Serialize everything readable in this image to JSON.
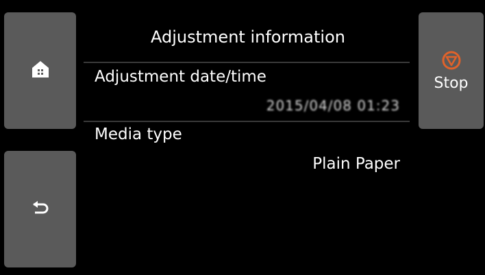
{
  "screen": {
    "title": "Adjustment information"
  },
  "buttons": {
    "home_icon": "home-icon",
    "back_icon": "back-arrow-icon",
    "stop_icon": "stop-icon",
    "stop_label": "Stop",
    "stop_icon_color": "#e0622a"
  },
  "fields": [
    {
      "label": "Adjustment date/time",
      "value": "2015/04/08 01:23"
    },
    {
      "label": "Media type",
      "value": "Plain Paper"
    }
  ]
}
